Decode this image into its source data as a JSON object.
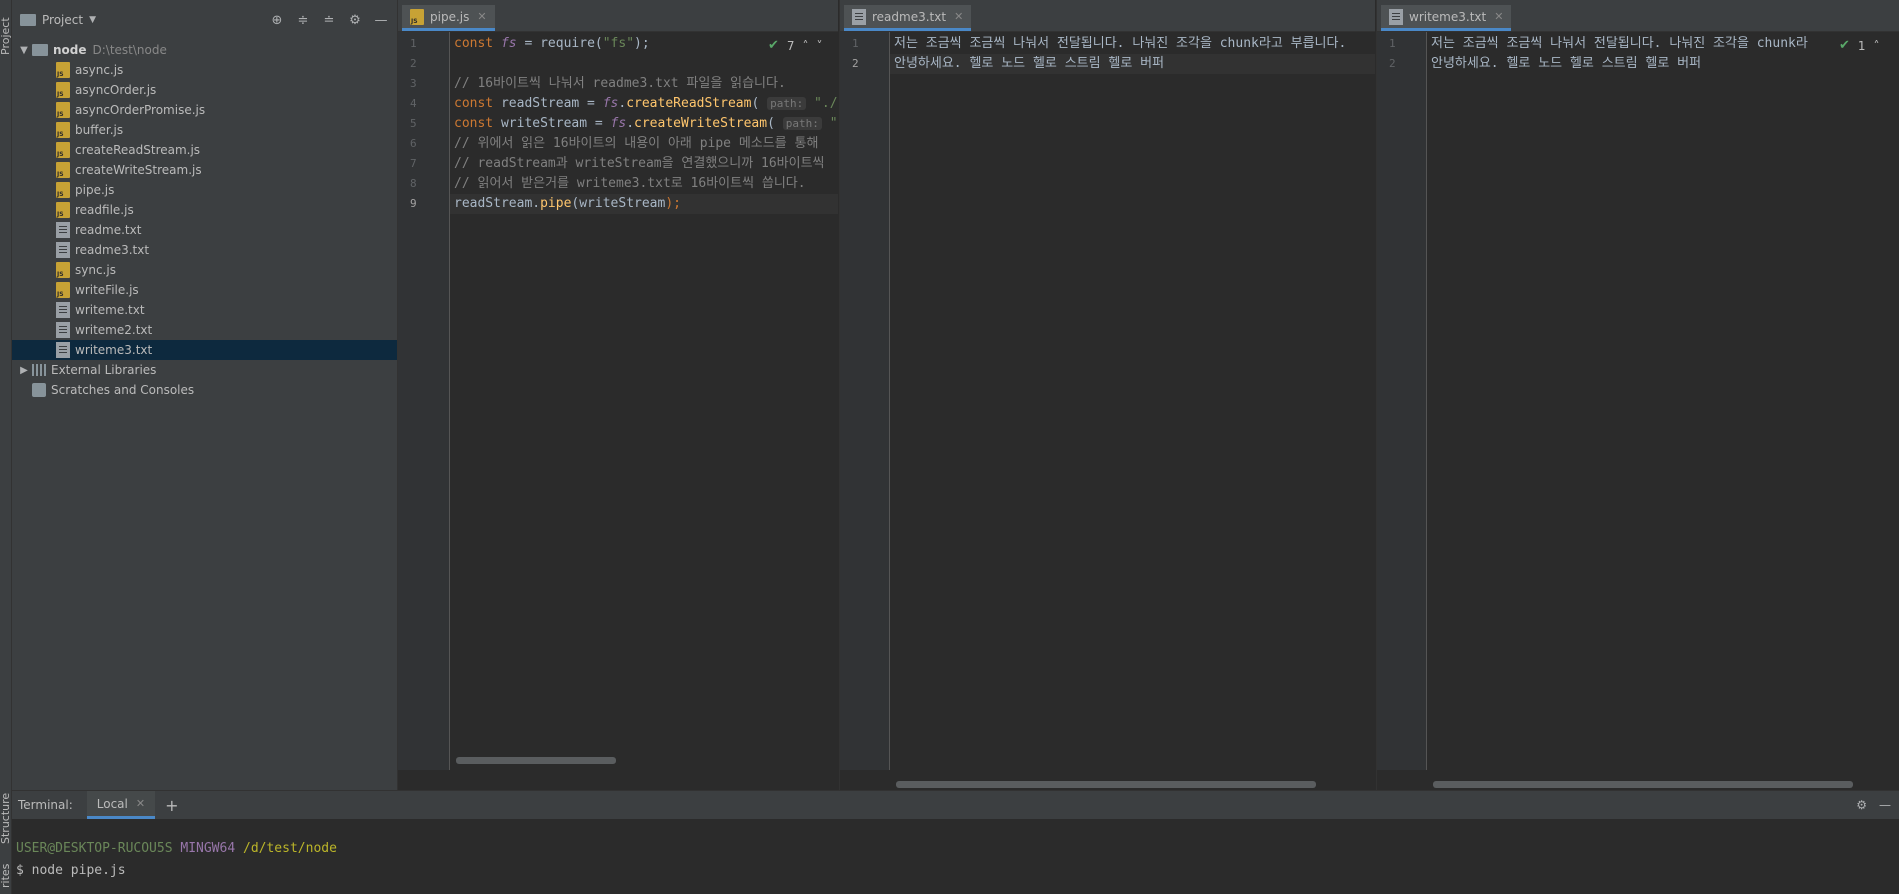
{
  "left_strip": {
    "project_tab": "Project",
    "structure_tab": "Structure",
    "favorites_tab": "rites"
  },
  "project": {
    "title": "Project",
    "root": {
      "name": "node",
      "path": "D:\\test\\node"
    },
    "files": [
      {
        "name": "async.js",
        "type": "js"
      },
      {
        "name": "asyncOrder.js",
        "type": "js"
      },
      {
        "name": "asyncOrderPromise.js",
        "type": "js"
      },
      {
        "name": "buffer.js",
        "type": "js"
      },
      {
        "name": "createReadStream.js",
        "type": "js"
      },
      {
        "name": "createWriteStream.js",
        "type": "js"
      },
      {
        "name": "pipe.js",
        "type": "js"
      },
      {
        "name": "readfile.js",
        "type": "js"
      },
      {
        "name": "readme.txt",
        "type": "txt"
      },
      {
        "name": "readme3.txt",
        "type": "txt"
      },
      {
        "name": "sync.js",
        "type": "js"
      },
      {
        "name": "writeFile.js",
        "type": "js"
      },
      {
        "name": "writeme.txt",
        "type": "txt"
      },
      {
        "name": "writeme2.txt",
        "type": "txt"
      },
      {
        "name": "writeme3.txt",
        "type": "txt",
        "selected": true
      }
    ],
    "external_libraries": "External Libraries",
    "scratches": "Scratches and Consoles"
  },
  "editor1": {
    "tab": "pipe.js",
    "inspection_count": "7",
    "line_numbers": [
      "1",
      "2",
      "3",
      "4",
      "5",
      "6",
      "7",
      "8",
      "9"
    ],
    "lines": {
      "l1": {
        "kw": "const ",
        "var": "fs",
        "rest": " = require(",
        "str": "\"fs\"",
        "end": ");"
      },
      "l3": "// 16바이트씩 나눠서 readme3.txt 파일을 읽습니다.",
      "l4": {
        "kw": "const ",
        "name": "readStream = ",
        "var": "fs",
        "dot": ".",
        "fn": "createReadStream",
        "open": "(",
        "hint": "path:",
        "str": "\"./r"
      },
      "l5": {
        "kw": "const ",
        "name": "writeStream = ",
        "var": "fs",
        "dot": ".",
        "fn": "createWriteStream",
        "open": "(",
        "hint": "path:",
        "str": "\"."
      },
      "l6": "// 위에서 읽은 16바이트의 내용이 아래 pipe 메소드를 통해",
      "l7": "// readStream과 writeStream을 연결했으니까 16바이트씩",
      "l8": "// 읽어서 받은거를 writeme3.txt로 16바이트씩 씁니다.",
      "l9": {
        "obj": "readStream.",
        "fn": "pipe",
        "open": "(",
        "arg": "writeStream",
        "end": ");"
      }
    }
  },
  "editor2": {
    "tab": "readme3.txt",
    "line_numbers": [
      "1",
      "2"
    ],
    "lines": [
      "저는 조금씩 조금씩 나눠서 전달됩니다. 나눠진 조각을 chunk라고 부릅니다.",
      "안녕하세요. 헬로 노드 헬로 스트림 헬로 버퍼"
    ]
  },
  "editor3": {
    "tab": "writeme3.txt",
    "inspection_count": "1",
    "line_numbers": [
      "1",
      "2"
    ],
    "lines": [
      "저는 조금씩 조금씩 나눠서 전달됩니다. 나눠진 조각을 chunk라",
      "안녕하세요. 헬로 노드 헬로 스트림 헬로 버퍼"
    ]
  },
  "terminal": {
    "label": "Terminal:",
    "tab": "Local",
    "prompt_user": "USER@DESKTOP-RUCOU5S",
    "prompt_shell": "MINGW64",
    "prompt_path": "/d/test/node",
    "command": "$ node pipe.js"
  },
  "colors": {
    "accent": "#4a88c7",
    "keyword": "#cc7832",
    "string": "#6a8759",
    "function": "#ffc66d",
    "comment": "#808080"
  }
}
